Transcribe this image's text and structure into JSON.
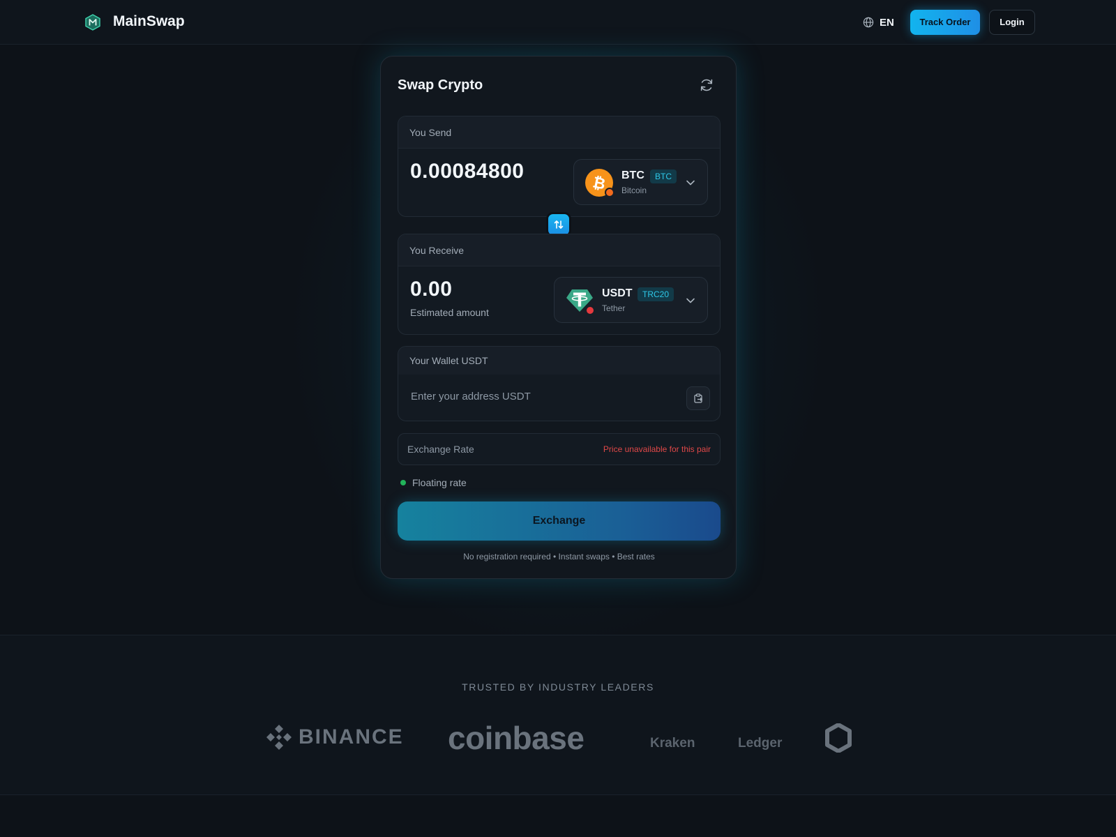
{
  "header": {
    "brand": "MainSwap",
    "language": "EN",
    "track_order": "Track Order",
    "login": "Login"
  },
  "swap": {
    "title": "Swap Crypto",
    "send": {
      "label": "You Send",
      "amount": "0.00084800",
      "coin": {
        "symbol": "BTC",
        "network": "BTC",
        "name": "Bitcoin",
        "color": "#f7931a",
        "dot_color": "#f26b1d"
      }
    },
    "receive": {
      "label": "You Receive",
      "amount": "0.00",
      "estimate_label": "Estimated amount",
      "coin": {
        "symbol": "USDT",
        "network": "TRC20",
        "name": "Tether",
        "color": "#3aa887",
        "dot_color": "#e5393e"
      }
    },
    "wallet": {
      "label": "Your Wallet USDT",
      "placeholder": "Enter your address USDT",
      "value": ""
    },
    "rate": {
      "label": "Exchange Rate",
      "value": "Price unavailable for this pair",
      "status_color": "#e04848"
    },
    "floating_rate": "Floating rate",
    "exchange_button": "Exchange",
    "footnote": "No registration required • Instant swaps • Best rates"
  },
  "trusted": {
    "title": "TRUSTED BY INDUSTRY LEADERS",
    "partners": [
      "BINANCE",
      "coinbase",
      "Kraken",
      "Ledger"
    ]
  },
  "icons": {
    "logo": "hexagon-m-logo-icon",
    "language": "globe-icon",
    "refresh": "refresh-icon",
    "swap": "swap-arrows-icon",
    "paste": "clipboard-paste-icon",
    "chevron": "chevron-down-icon"
  }
}
